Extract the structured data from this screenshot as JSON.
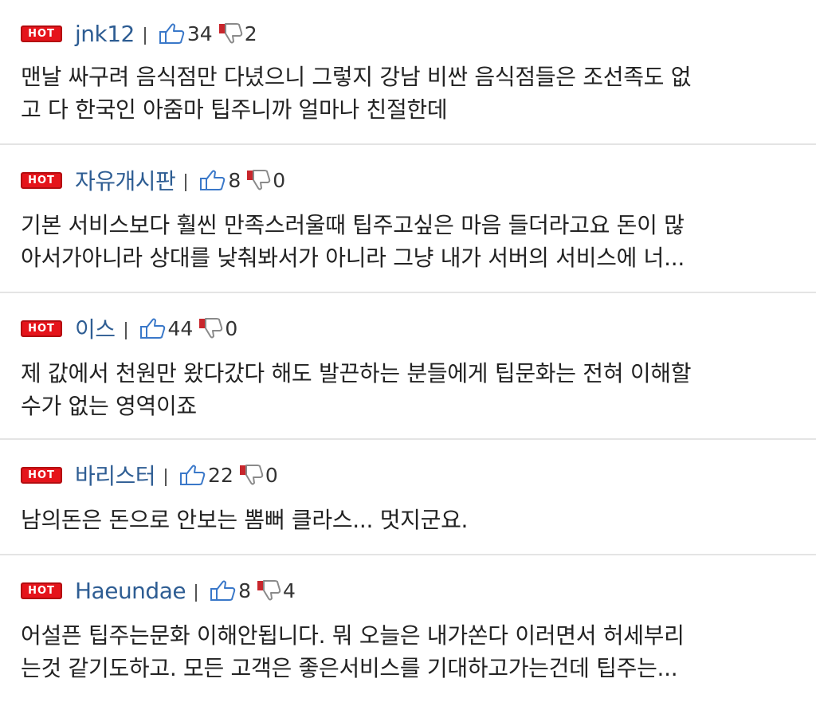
{
  "badge_label": "HOT",
  "comments": [
    {
      "nickname": "jnk12",
      "likes": "34",
      "dislikes": "2",
      "lines": [
        "맨날 싸구려 음식점만 다녔으니 그렇지 강남 비싼 음식점들은 조선족도 없",
        "고 다 한국인 아줌마 팁주니까 얼마나 친절한데"
      ]
    },
    {
      "nickname": "자유개시판",
      "likes": "8",
      "dislikes": "0",
      "lines": [
        "기본 서비스보다 훨씬 만족스러울때 팁주고싶은 마음 들더라고요 돈이 많",
        "아서가아니라 상대를 낮춰봐서가 아니라 그냥 내가 서버의 서비스에 너..."
      ]
    },
    {
      "nickname": "이스",
      "likes": "44",
      "dislikes": "0",
      "lines": [
        "제 값에서 천원만 왔다갔다 해도 발끈하는 분들에게 팁문화는 전혀 이해할",
        "수가 없는 영역이죠"
      ]
    },
    {
      "nickname": "바리스터",
      "likes": "22",
      "dislikes": "0",
      "lines": [
        "남의돈은 돈으로 안보는 뽐뻐 클라스... 멋지군요."
      ]
    },
    {
      "nickname": "Haeundae",
      "likes": "8",
      "dislikes": "4",
      "lines": [
        "어설픈 팁주는문화 이해안됩니다. 뭐 오늘은 내가쏜다 이러면서 허세부리",
        "는것 같기도하고. 모든 고객은 좋은서비스를 기대하고가는건데 팁주는..."
      ]
    }
  ],
  "colors": {
    "hot_badge": "#e5141b",
    "nickname": "#2e5d93",
    "like_icon": "#3a78c9",
    "dislike_icon": "#c8262c",
    "divider": "#e4e4e4"
  },
  "icons": {
    "like": "thumbs-up-icon",
    "dislike": "thumbs-down-icon"
  }
}
